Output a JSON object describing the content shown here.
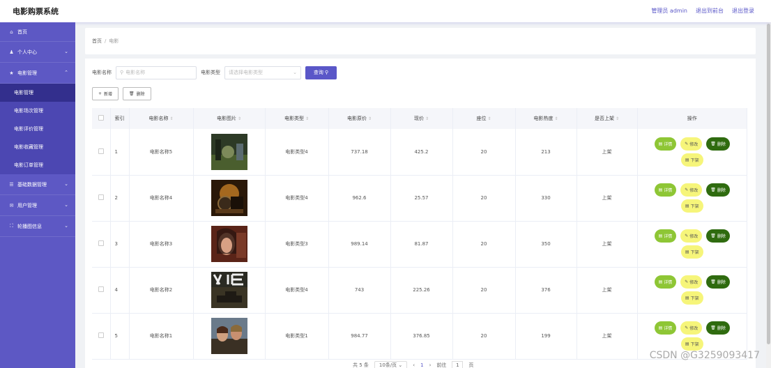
{
  "app": {
    "title": "电影购票系统"
  },
  "topbar": {
    "admin": "管理员 admin",
    "front": "退出到前台",
    "logout": "退出登录"
  },
  "sidebar": {
    "home": "首页",
    "personal": "个人中心",
    "movie_mgmt": "电影管理",
    "submenu": [
      "电影管理",
      "电影场次管理",
      "电影评价管理",
      "电影收藏管理",
      "电影订单管理"
    ],
    "base_data": "基础数据管理",
    "user_mgmt": "用户管理",
    "carousel": "轮播图信息"
  },
  "breadcrumb": {
    "home": "首页",
    "sep": "/",
    "current": "电影"
  },
  "search": {
    "name_label": "电影名称",
    "name_placeholder": "电影名称",
    "type_label": "电影类型",
    "type_placeholder": "请选择电影类型",
    "query_label": "查询"
  },
  "actions": {
    "add": "新增",
    "delete": "删除"
  },
  "table": {
    "headers": [
      "索引",
      "电影名称",
      "电影图片",
      "电影类型",
      "电影原价",
      "现价",
      "座位",
      "电影热度",
      "是否上架",
      "操作"
    ],
    "rows": [
      {
        "index": "1",
        "name": "电影名称5",
        "type": "电影类型4",
        "orig": "737.18",
        "price": "425.2",
        "seats": "20",
        "heat": "213",
        "status": "上架"
      },
      {
        "index": "2",
        "name": "电影名称4",
        "type": "电影类型4",
        "orig": "962.6",
        "price": "25.57",
        "seats": "20",
        "heat": "330",
        "status": "上架"
      },
      {
        "index": "3",
        "name": "电影名称3",
        "type": "电影类型3",
        "orig": "989.14",
        "price": "81.87",
        "seats": "20",
        "heat": "350",
        "status": "上架"
      },
      {
        "index": "4",
        "name": "电影名称2",
        "type": "电影类型4",
        "orig": "743",
        "price": "225.26",
        "seats": "20",
        "heat": "376",
        "status": "上架"
      },
      {
        "index": "5",
        "name": "电影名称1",
        "type": "电影类型1",
        "orig": "984.77",
        "price": "376.85",
        "seats": "20",
        "heat": "199",
        "status": "上架"
      }
    ],
    "ops": {
      "detail": "详情",
      "edit": "修改",
      "del": "删除",
      "off": "下架"
    }
  },
  "pager": {
    "total": "共 5 条",
    "size": "10条/页",
    "page": "1",
    "goto": "前往",
    "goto_value": "1",
    "unit": "页"
  },
  "watermark": "CSDN @G3259093417",
  "colors": {
    "primary": "#5a57c8",
    "sidebar": "#5d58c4",
    "detail": "#8ec635",
    "edit": "#f6f57a",
    "delete": "#2f6b0f"
  }
}
